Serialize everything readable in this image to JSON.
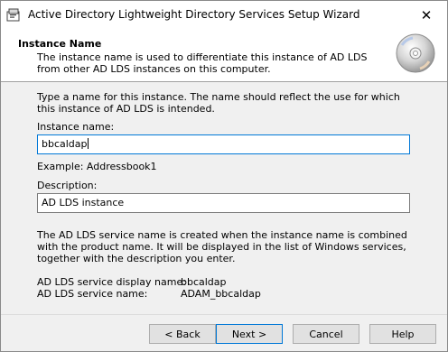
{
  "window": {
    "title": "Active Directory Lightweight Directory Services Setup Wizard",
    "close_label": "✕"
  },
  "header": {
    "title": "Instance Name",
    "description": "The instance name is used to differentiate this instance of AD LDS from other AD LDS instances on this computer."
  },
  "main": {
    "intro": "Type a name for this instance. The name should reflect the use for which this instance of AD LDS is intended.",
    "instance_name_label": "Instance name:",
    "instance_name_value": "bbcaldap",
    "example": "Example: Addressbook1",
    "description_label": "Description:",
    "description_value": "AD LDS instance",
    "service_info": "The AD LDS service name is created when the instance name is combined with the product name. It will be displayed in the list of Windows services, together with the description you enter.",
    "display_name_label": "AD LDS service display name:",
    "display_name_value": "bbcaldap",
    "service_name_label": "AD LDS service name:",
    "service_name_value": "ADAM_bbcaldap"
  },
  "buttons": {
    "back": "< Back",
    "next": "Next >",
    "cancel": "Cancel",
    "help": "Help"
  },
  "icons": {
    "app": "setup-wizard-icon",
    "header": "cd-disc-icon",
    "close": "close-icon"
  },
  "colors": {
    "focus_border": "#0078d7",
    "content_bg": "#f0f0f0"
  }
}
